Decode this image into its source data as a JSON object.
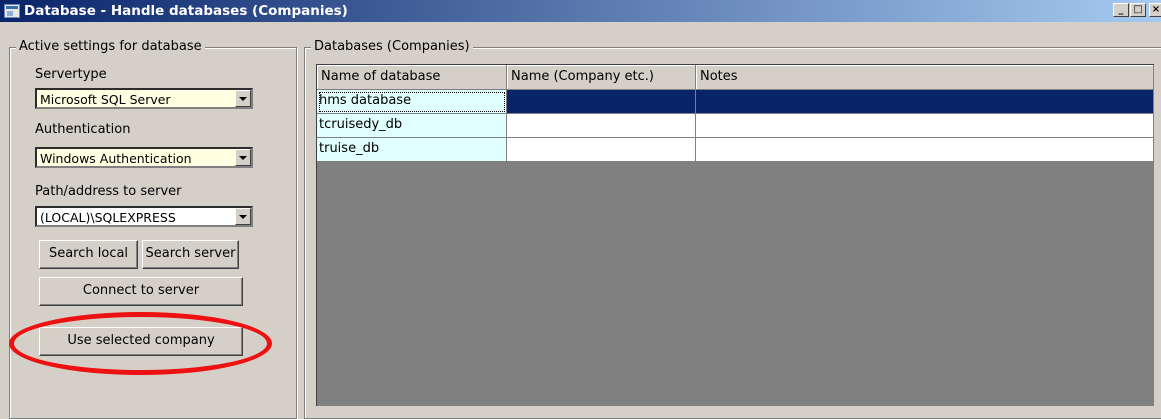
{
  "window": {
    "title": "Database - Handle databases (Companies)",
    "controls": {
      "minimize": "_",
      "maximize": "□",
      "close": "×"
    }
  },
  "settings": {
    "group_title": "Active settings for database",
    "servertype_label": "Servertype",
    "servertype_value": "Microsoft SQL Server",
    "authentication_label": "Authentication",
    "authentication_value": "Windows Authentication",
    "path_label": "Path/address to server",
    "path_value": "(LOCAL)\\SQLEXPRESS",
    "search_local_label": "Search local",
    "search_server_label": "Search server",
    "connect_label": "Connect to server",
    "use_selected_label": "Use selected company"
  },
  "databases": {
    "group_title": "Databases (Companies)",
    "columns": [
      "Name of database",
      "Name (Company etc.)",
      "Notes"
    ],
    "rows": [
      [
        "hms database",
        "",
        ""
      ],
      [
        "tcruisedy_db",
        "",
        ""
      ],
      [
        "truise_db",
        "",
        ""
      ]
    ],
    "selected_row": 0
  },
  "colors": {
    "window_bg": "#d4d0c8",
    "title_bar_start": "#0a246a",
    "title_bar_end": "#a6caf0",
    "selection": "#0a246a",
    "first_column_bg": "#e0ffff",
    "combo_highlight": "#ffffe1",
    "annotation_circle": "#ee1111"
  }
}
